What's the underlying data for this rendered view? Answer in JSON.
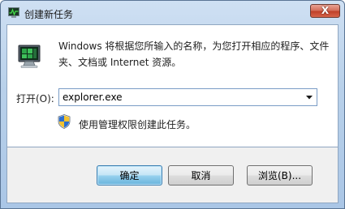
{
  "window": {
    "title": "创建新任务",
    "close_glyph": "X"
  },
  "dialog": {
    "description": "Windows 将根据您所输入的名称，为您打开相应的程序、文件夹、文档或 Internet 资源。",
    "open_label": "打开(O):",
    "open_value": "explorer.exe",
    "admin_note": "使用管理权限创建此任务。"
  },
  "buttons": {
    "ok": "确定",
    "cancel": "取消",
    "browse": "浏览(B)..."
  },
  "colors": {
    "titlebar": "#b9d1ea",
    "close_button": "#c0412a",
    "default_button": "#98d1ef"
  }
}
